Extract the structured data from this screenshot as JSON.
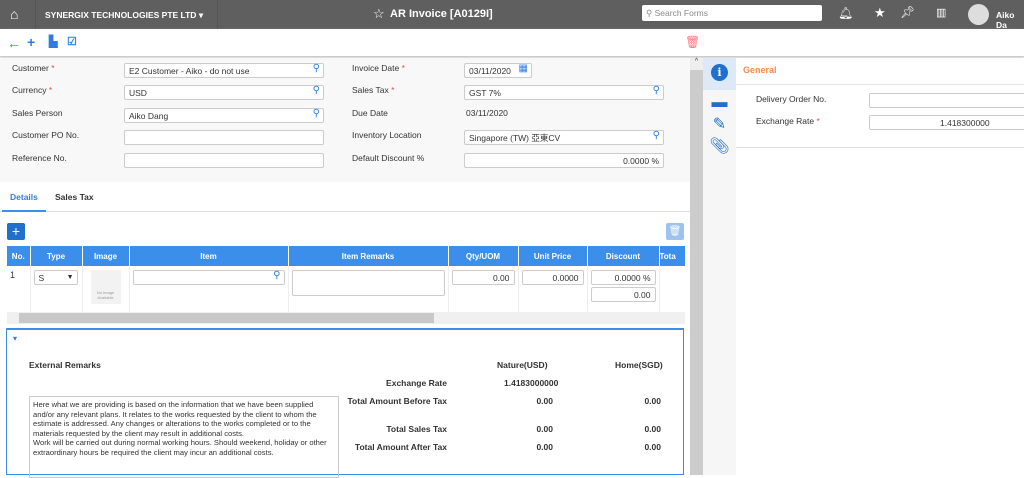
{
  "header": {
    "company": "SYNERGIX TECHNOLOGIES PTE LTD",
    "title": "AR Invoice [A0129I]",
    "search_placeholder": "Search Forms",
    "user": "Aiko Da"
  },
  "form": {
    "customer_label": "Customer",
    "customer": "E2 Customer - Aiko - do not use",
    "currency_label": "Currency",
    "currency": "USD",
    "sales_person_label": "Sales Person",
    "sales_person": "Aiko Dang",
    "customer_po_label": "Customer PO No.",
    "customer_po": "",
    "reference_label": "Reference No.",
    "reference": "",
    "invoice_date_label": "Invoice Date",
    "invoice_date": "03/11/2020",
    "sales_tax_label": "Sales Tax",
    "sales_tax": "GST 7%",
    "due_date_label": "Due Date",
    "due_date": "03/11/2020",
    "inventory_label": "Inventory Location",
    "inventory": "Singapore (TW) 亞東CV",
    "discount_label": "Default Discount %",
    "discount": "0.0000 %"
  },
  "tabs": [
    "Details",
    "Sales Tax"
  ],
  "table": {
    "headers": [
      "No.",
      "Type",
      "Image",
      "Item",
      "Item Remarks",
      "Qty/UOM",
      "Unit Price",
      "Discount",
      "Tota"
    ],
    "row": {
      "no": "1",
      "type": "S",
      "image_text": "No Image Available",
      "qty": "0.00",
      "unit_price": "0.0000",
      "discount_pct": "0.0000 %",
      "discount_amt": "0.00"
    }
  },
  "bottom": {
    "ext_label": "External Remarks",
    "remarks": "Here what we are providing is based on the information that we have been supplied and/or any relevant plans. It relates to the works requested by the client to whom the estimate is addressed. Any changes or alterations to the works completed or to the materials requested by the client may result in additional costs.\nWork will be carried out during normal working hours. Should weekend, holiday or other extraordinary hours be required the client may incur an additional costs.",
    "nature": "Nature(USD)",
    "home": "Home(SGD)",
    "rows": [
      {
        "label": "Exchange Rate",
        "n": "1.4183000000",
        "h": ""
      },
      {
        "label": "Total Amount Before Tax",
        "n": "0.00",
        "h": "0.00"
      },
      {
        "label": "Total Sales Tax",
        "n": "0.00",
        "h": "0.00"
      },
      {
        "label": "Total Amount After Tax",
        "n": "0.00",
        "h": "0.00"
      }
    ]
  },
  "right": {
    "section": "General",
    "do_label": "Delivery Order No.",
    "do": "",
    "rate_label": "Exchange Rate",
    "rate": "1.418300000"
  }
}
